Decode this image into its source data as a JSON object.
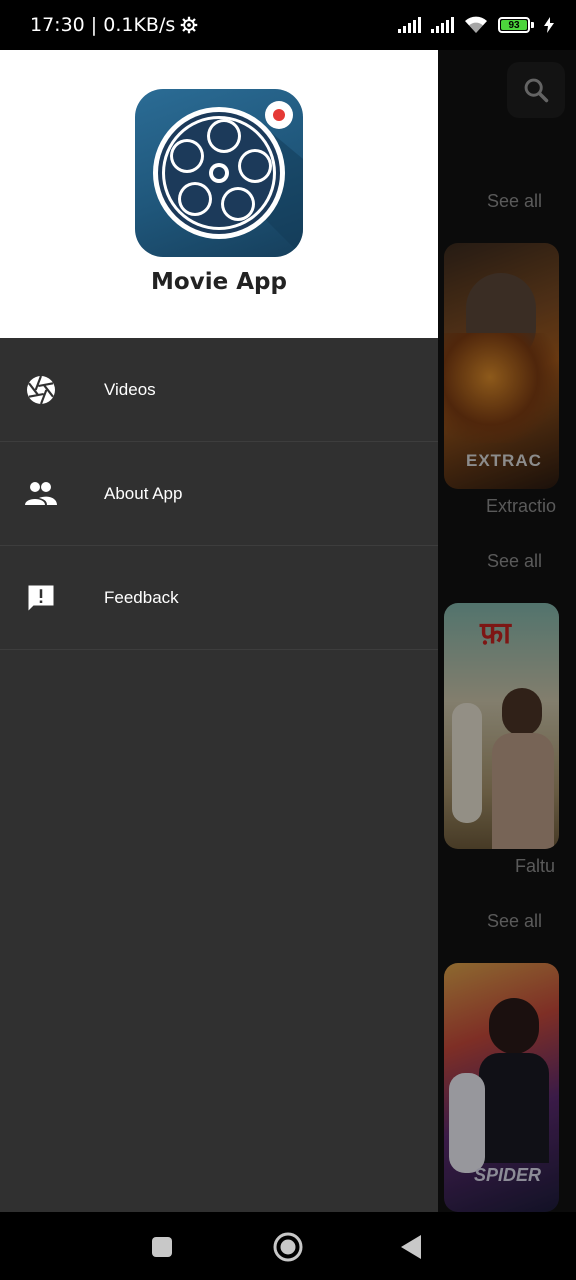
{
  "status_bar": {
    "time": "17:30",
    "net_speed": "0.1KB/s",
    "battery_level": "93"
  },
  "drawer": {
    "app_name": "Movie App",
    "items": [
      {
        "label": "Videos",
        "icon": "aperture-icon"
      },
      {
        "label": "About App",
        "icon": "people-icon"
      },
      {
        "label": "Feedback",
        "icon": "feedback-icon"
      }
    ]
  },
  "background": {
    "see_all": [
      "See all",
      "See all",
      "See all"
    ],
    "poster_titles": [
      "Extractio",
      "Faltu"
    ],
    "poster_texts": [
      "EXTRAC",
      "SPIDER"
    ]
  },
  "colors": {
    "drawer_bg": "#303030",
    "header_bg": "#ffffff",
    "battery_green": "#4cd43c",
    "logo_blue": "#2b6c95",
    "record_red": "#e53935"
  }
}
